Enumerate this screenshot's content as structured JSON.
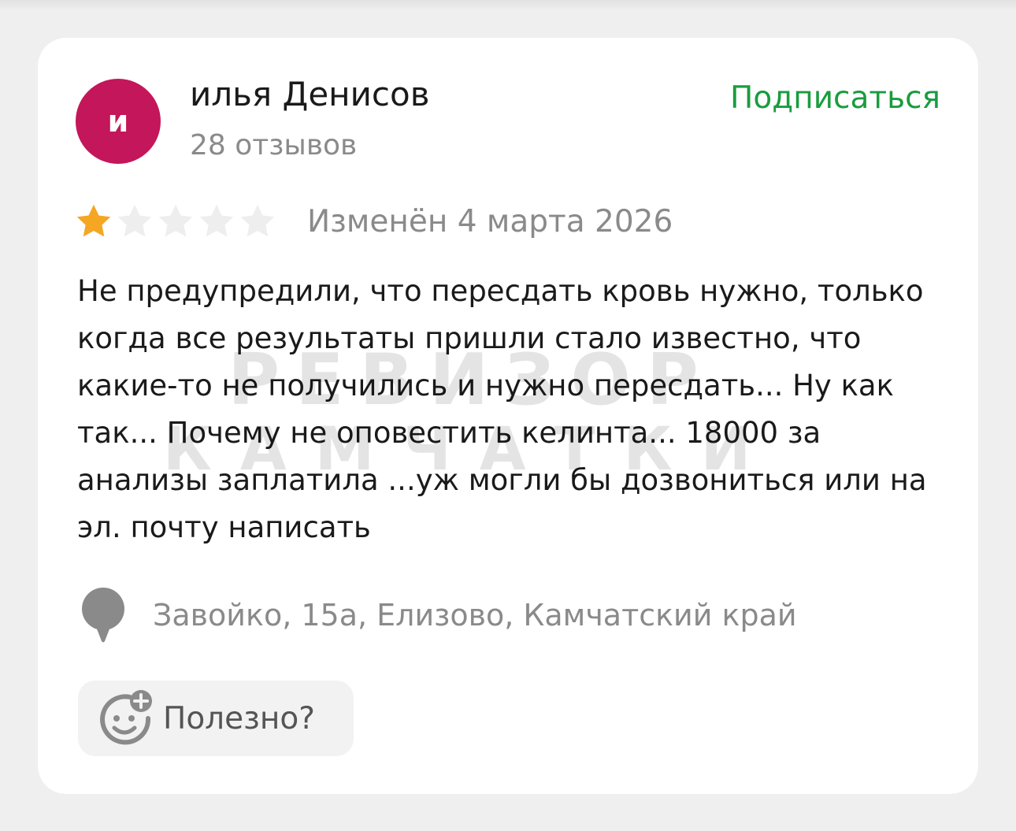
{
  "review": {
    "author": {
      "avatar_letter": "и",
      "avatar_color": "#c4165a",
      "name": "илья Денисов",
      "reviews_count": "28 отзывов"
    },
    "subscribe_label": "Подписаться",
    "subscribe_color": "#1a9c3e",
    "rating": {
      "value": 1,
      "max": 5,
      "filled_color": "#f5a623",
      "empty_color": "#eeeeee"
    },
    "edited_date": "Изменён 4 марта 2026",
    "text": "Не предупредили, что пересдать кровь нужно, только когда все результаты пришли стало известно, что какие-то не получились и нужно пересдать... Ну как так... Почему не оповестить келинта... 18000 за анализы заплатила ...уж могли бы дозвониться или на эл. почту написать",
    "location": {
      "icon": "map-pin-icon",
      "address": "Завойко, 15а, Елизово, Камчатский край"
    },
    "helpful": {
      "icon": "smile-plus-icon",
      "label": "Полезно?"
    }
  },
  "watermark": {
    "line1": "РЕВИЗОР",
    "line2": "КАМЧАТКИ"
  }
}
